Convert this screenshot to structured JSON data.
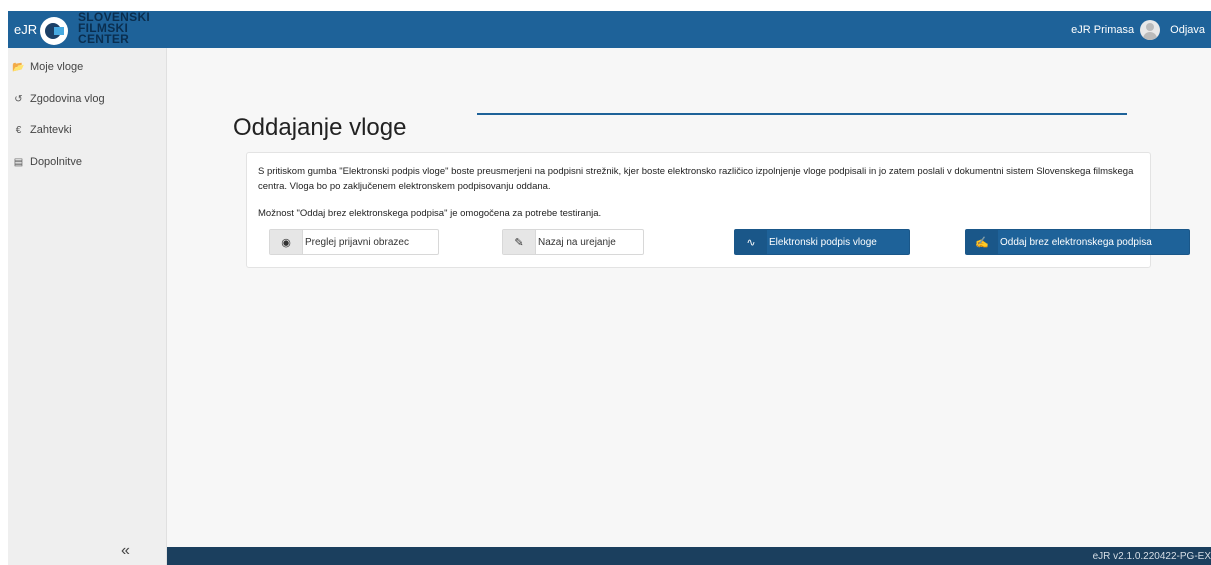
{
  "header": {
    "app_name": "eJR",
    "logo_lines": [
      "SLOVENSKI",
      "FILMSKI",
      "CENTER"
    ],
    "user_name": "eJR Primasa",
    "logout_label": "Odjava"
  },
  "sidebar": {
    "items": [
      {
        "label": "Moje vloge",
        "icon": "folder-open-icon",
        "glyph": "📂"
      },
      {
        "label": "Zgodovina vlog",
        "icon": "history-icon",
        "glyph": "↺"
      },
      {
        "label": "Zahtevki",
        "icon": "euro-icon",
        "glyph": "€"
      },
      {
        "label": "Dopolnitve",
        "icon": "document-icon",
        "glyph": "▤"
      }
    ],
    "collapse_label": "«"
  },
  "main": {
    "title": "Oddajanje vloge",
    "paragraph": "S pritiskom gumba \"Elektronski podpis vloge\" boste preusmerjeni na podpisni strežnik, kjer boste elektronsko različico izpolnjenje vloge podpisali in jo zatem poslali v dokumentni sistem Slovenskega filmskega centra. Vloga bo po zaključenem elektronskem podpisovanju oddana.",
    "note": "Možnost \"Oddaj brez elektronskega podpisa\" je omogočena za potrebe testiranja.",
    "buttons": {
      "preview": {
        "label": "Preglej prijavni obrazec",
        "icon": "eye-icon",
        "glyph": "◉"
      },
      "edit": {
        "label": "Nazaj na urejanje",
        "icon": "edit-icon",
        "glyph": "✎"
      },
      "sign": {
        "label": "Elektronski podpis vloge",
        "icon": "signature-icon",
        "glyph": "∿"
      },
      "submit": {
        "label": "Oddaj brez elektronskega podpisa",
        "icon": "document-edit-icon",
        "glyph": "✍"
      }
    }
  },
  "footer": {
    "version": "eJR v2.1.0.220422-PG-EX"
  },
  "colors": {
    "primary": "#1e6299",
    "footer": "#1b3f5e",
    "sidebar_bg": "#efefef"
  }
}
